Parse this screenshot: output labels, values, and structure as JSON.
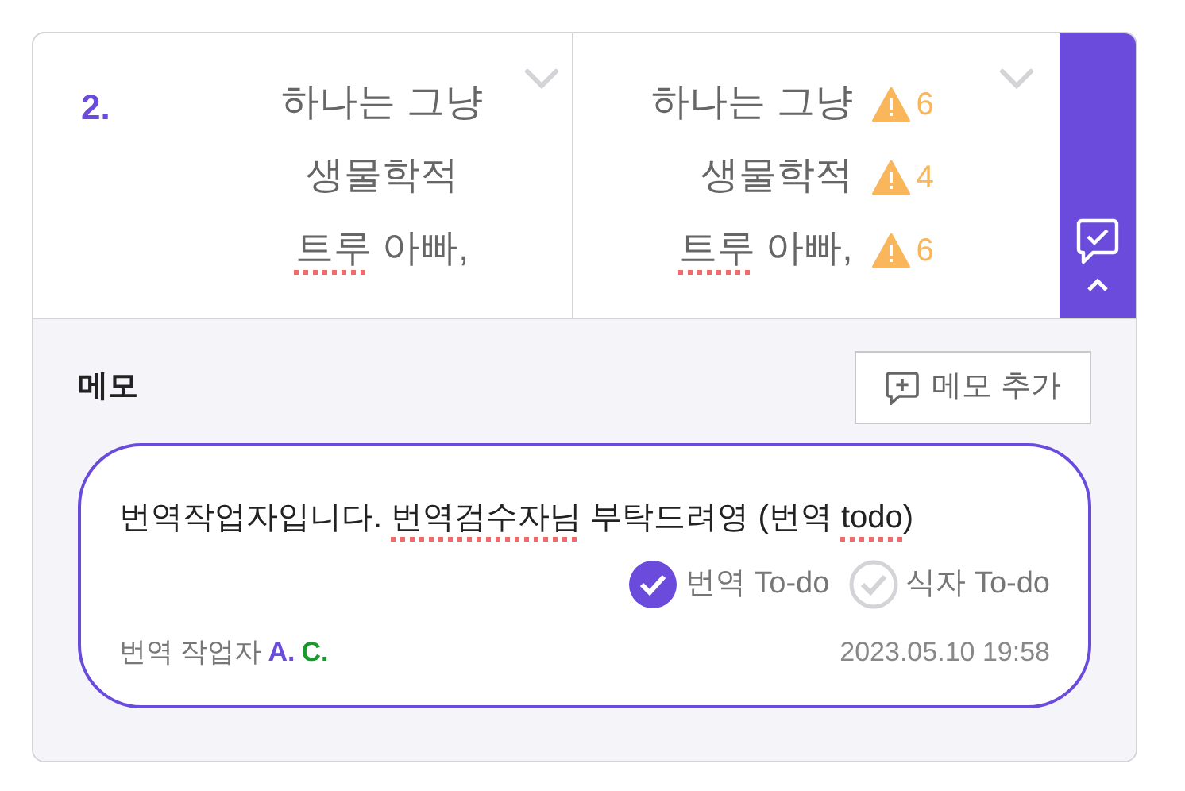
{
  "segment": {
    "number": "2.",
    "source": {
      "lines": [
        {
          "segments": [
            {
              "text": "하나는 그냥",
              "flagged": false
            }
          ]
        },
        {
          "segments": [
            {
              "text": "생물학적",
              "flagged": false
            }
          ]
        },
        {
          "segments": [
            {
              "text": "트루",
              "flagged": true
            },
            {
              "text": " 아빠,",
              "flagged": false
            }
          ]
        }
      ]
    },
    "target": {
      "lines": [
        {
          "segments": [
            {
              "text": "하나는 그냥",
              "flagged": false
            }
          ],
          "warning": "6"
        },
        {
          "segments": [
            {
              "text": "생물학적",
              "flagged": false
            }
          ],
          "warning": "4"
        },
        {
          "segments": [
            {
              "text": "트루",
              "flagged": true
            },
            {
              "text": " 아빠,",
              "flagged": false
            }
          ],
          "warning": "6"
        }
      ]
    }
  },
  "memo": {
    "title": "메모",
    "add_button": "메모 추가",
    "note": {
      "segments": [
        {
          "text": "번역작업자입니다. ",
          "flagged": false
        },
        {
          "text": "번역검수자님",
          "flagged": true
        },
        {
          "text": " 부탁드려영 (번역 ",
          "flagged": false
        },
        {
          "text": "todo",
          "flagged": true
        },
        {
          "text": ")",
          "flagged": false
        }
      ],
      "todos": [
        {
          "label": "번역 To-do",
          "checked": true
        },
        {
          "label": "식자 To-do",
          "checked": false
        }
      ],
      "author_label": "번역 작업자",
      "authors": [
        {
          "name": "A.",
          "color": "#6a4bdc"
        },
        {
          "name": "C.",
          "color": "#1a9a2a"
        }
      ],
      "timestamp": "2023.05.10 19:58"
    }
  }
}
